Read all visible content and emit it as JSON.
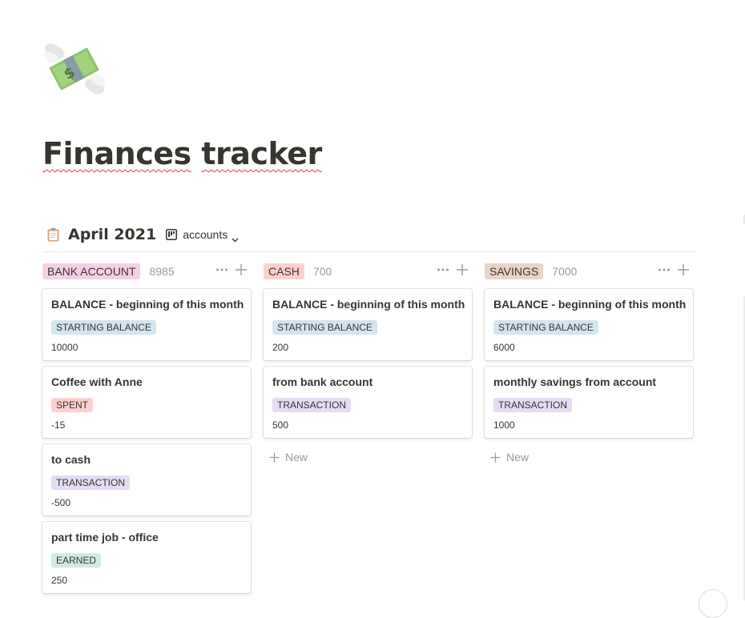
{
  "page": {
    "icon": "money-with-wings-icon",
    "title_words": [
      "Finances",
      "tracker"
    ]
  },
  "database": {
    "icon": "clipboard-icon",
    "title": "April 2021",
    "view": {
      "icon": "board-view-icon",
      "label": "accounts",
      "chevron": "chevron-down-icon"
    }
  },
  "colors": {
    "pink": "#f5cfe4",
    "red": "#ffcfcf",
    "orange_brown": "#ead4c8",
    "blue": "#d3e5ef",
    "purple": "#e4dbf5",
    "green": "#d2ebe2"
  },
  "columns": [
    {
      "label": "BANK ACCOUNT",
      "count": "8985",
      "color": "#f5cfe4",
      "cards": [
        {
          "title": "BALANCE - beginning of this month",
          "tag": "STARTING BALANCE",
          "tag_color": "#d3e5ef",
          "value": "10000"
        },
        {
          "title": "Coffee with Anne",
          "tag": "SPENT",
          "tag_color": "#ffcfcf",
          "value": "-15"
        },
        {
          "title": "to cash",
          "tag": "TRANSACTION",
          "tag_color": "#e4dbf5",
          "value": "-500"
        },
        {
          "title": "part time job - office",
          "tag": "EARNED",
          "tag_color": "#d2ebe2",
          "value": "250"
        }
      ]
    },
    {
      "label": "CASH",
      "count": "700",
      "color": "#ffcfcf",
      "cards": [
        {
          "title": "BALANCE - beginning of this month",
          "tag": "STARTING BALANCE",
          "tag_color": "#d3e5ef",
          "value": "200"
        },
        {
          "title": "from bank account",
          "tag": "TRANSACTION",
          "tag_color": "#e4dbf5",
          "value": "500"
        }
      ],
      "new_label": "New"
    },
    {
      "label": "SAVINGS",
      "count": "7000",
      "color": "#ead4c8",
      "cards": [
        {
          "title": "BALANCE - beginning of this month",
          "tag": "STARTING BALANCE",
          "tag_color": "#d3e5ef",
          "value": "6000"
        },
        {
          "title": "monthly savings from account",
          "tag": "TRANSACTION",
          "tag_color": "#e4dbf5",
          "value": "1000"
        }
      ],
      "new_label": "New"
    }
  ]
}
